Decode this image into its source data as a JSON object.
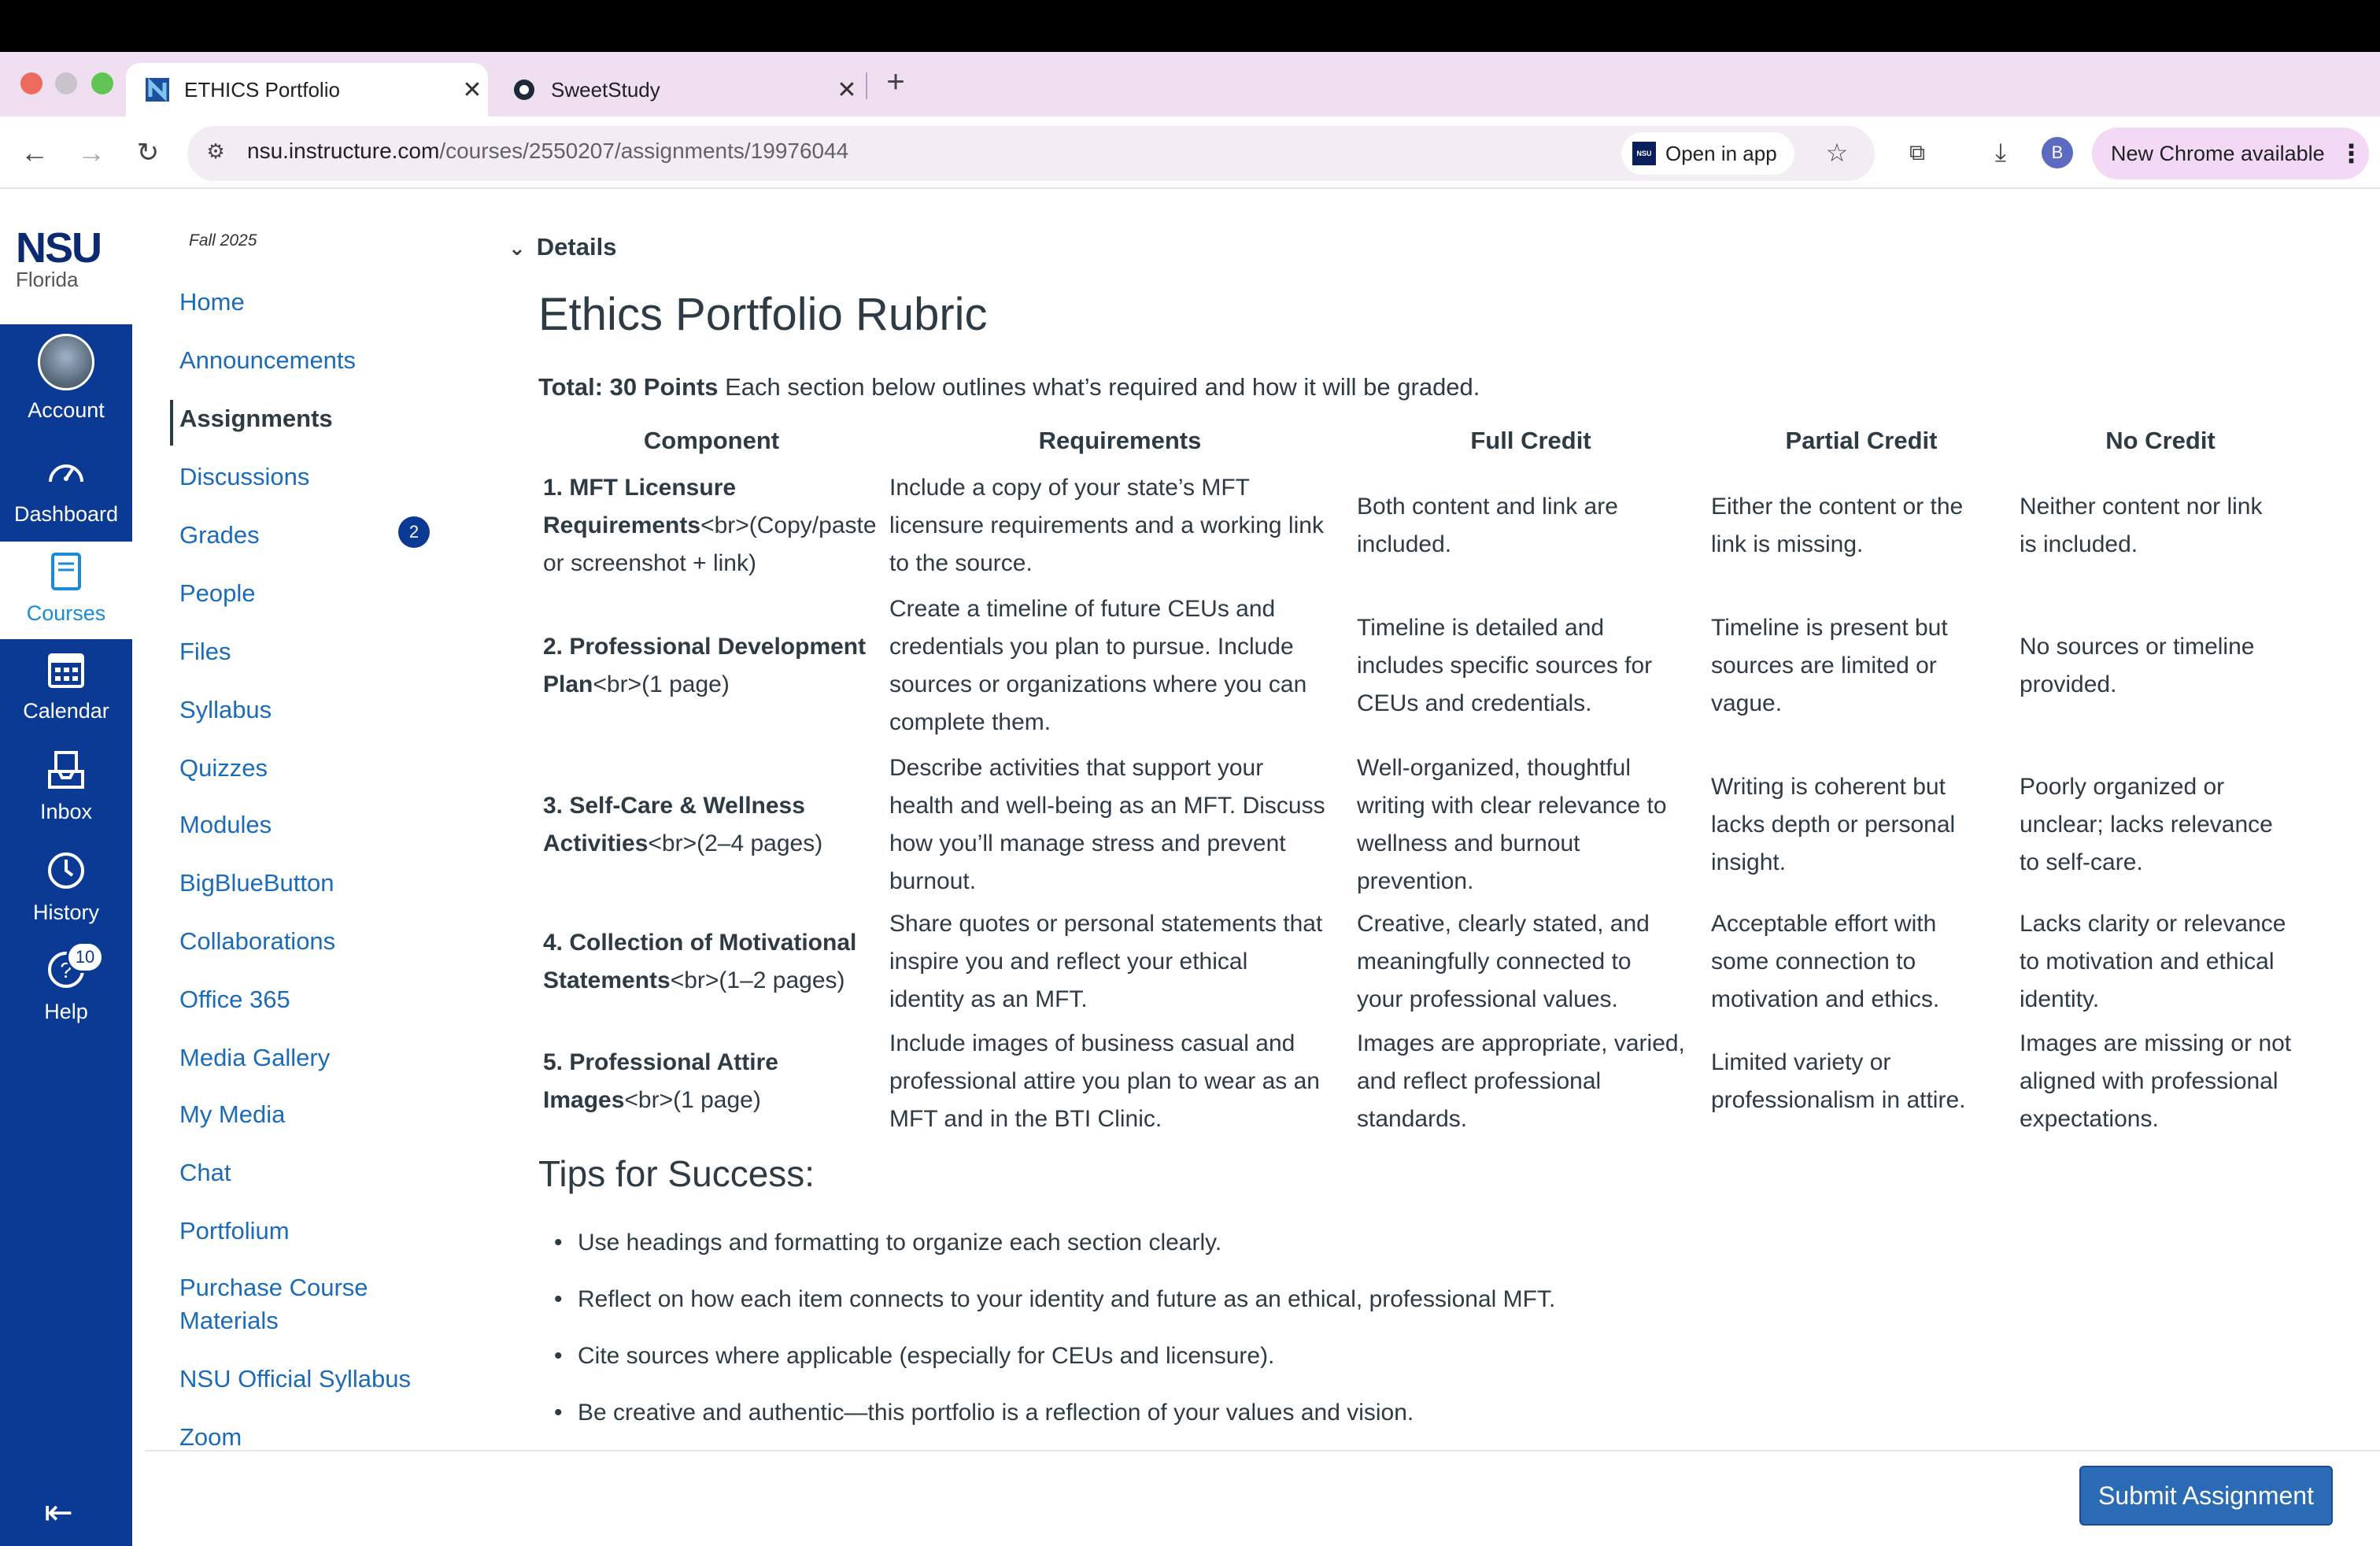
{
  "browser": {
    "tabs": [
      {
        "label": "ETHICS Portfolio",
        "active": true
      },
      {
        "label": "SweetStudy",
        "active": false
      }
    ],
    "url_host": "nsu.instructure.com",
    "url_path": "/courses/2550207/assignments/19976044",
    "open_in_app": "Open in app",
    "open_in_app_icon_text": "NSU",
    "profile_initial": "B",
    "new_chrome": "New Chrome available"
  },
  "global_nav": {
    "logo_main": "NSU",
    "logo_sub": "Florida",
    "items": [
      {
        "label": "Account",
        "icon": "account-avatar"
      },
      {
        "label": "Dashboard",
        "icon": "dashboard-icon"
      },
      {
        "label": "Courses",
        "icon": "courses-icon"
      },
      {
        "label": "Calendar",
        "icon": "calendar-icon"
      },
      {
        "label": "Inbox",
        "icon": "inbox-icon"
      },
      {
        "label": "History",
        "icon": "history-icon"
      },
      {
        "label": "Help",
        "icon": "help-icon"
      }
    ],
    "help_badge": "10"
  },
  "course_nav": {
    "term": "Fall 2025",
    "items": [
      "Home",
      "Announcements",
      "Assignments",
      "Discussions",
      "Grades",
      "People",
      "Files",
      "Syllabus",
      "Quizzes",
      "Modules",
      "BigBlueButton",
      "Collaborations",
      "Office 365",
      "Media Gallery",
      "My Media",
      "Chat",
      "Portfolium",
      "Purchase Course",
      "Materials",
      "NSU Official Syllabus",
      "Zoom"
    ],
    "grades_badge": "2"
  },
  "main": {
    "details_label": "Details",
    "title": "Ethics Portfolio Rubric",
    "total_bold": "Total: 30 Points",
    "total_rest": " Each section below outlines what’s required and how it will be graded.",
    "table": {
      "headers": [
        "Component",
        "Requirements",
        "Full Credit",
        "Partial Credit",
        "No Credit"
      ],
      "rows": [
        {
          "component": [
            "1. MFT Licensure",
            "Requirements",
            "<br>(Copy/paste",
            "or screenshot + link)"
          ],
          "requirements": [
            "Include a copy of your state’s MFT",
            "licensure requirements and a working link",
            "to the source."
          ],
          "full": [
            "Both content and link are",
            "included."
          ],
          "partial": [
            "Either the content or the",
            "link is missing."
          ],
          "none": [
            "Neither content nor link",
            "is included."
          ]
        },
        {
          "component": [
            "2. Professional Development",
            "Plan",
            "<br>(1 page)"
          ],
          "requirements": [
            "Create a timeline of future CEUs and",
            "credentials you plan to pursue. Include",
            "sources or organizations where you can",
            "complete them."
          ],
          "full": [
            "Timeline is detailed and",
            "includes specific sources for",
            "CEUs and credentials."
          ],
          "partial": [
            "Timeline is present but",
            "sources are limited or",
            "vague."
          ],
          "none": [
            "No sources or timeline",
            "provided."
          ]
        },
        {
          "component": [
            "3. Self-Care & Wellness",
            "Activities",
            "<br>(2–4 pages)"
          ],
          "requirements": [
            "Describe activities that support your",
            "health and well-being as an MFT. Discuss",
            "how you’ll manage stress and prevent",
            "burnout."
          ],
          "full": [
            "Well-organized, thoughtful",
            "writing with clear relevance to",
            "wellness and burnout",
            "prevention."
          ],
          "partial": [
            "Writing is coherent but",
            "lacks depth or personal",
            "insight."
          ],
          "none": [
            "Poorly organized or",
            "unclear; lacks relevance",
            "to self-care."
          ]
        },
        {
          "component": [
            "4. Collection of Motivational",
            "Statements",
            "<br>(1–2 pages)"
          ],
          "requirements": [
            "Share quotes or personal statements that",
            "inspire you and reflect your ethical",
            "identity as an MFT."
          ],
          "full": [
            "Creative, clearly stated, and",
            "meaningfully connected to",
            "your professional values."
          ],
          "partial": [
            "Acceptable effort with",
            "some connection to",
            "motivation and ethics."
          ],
          "none": [
            "Lacks clarity or relevance",
            "to motivation and ethical",
            "identity."
          ]
        },
        {
          "component": [
            "5. Professional Attire",
            "Images",
            "<br>(1 page)"
          ],
          "requirements": [
            "Include images of business casual and",
            "professional attire you plan to wear as an",
            "MFT and in the BTI Clinic."
          ],
          "full": [
            "Images are appropriate, varied,",
            "and reflect professional",
            "standards."
          ],
          "partial": [
            "Limited variety or",
            "professionalism in attire."
          ],
          "none": [
            "Images are missing or not",
            "aligned with professional",
            "expectations."
          ]
        }
      ]
    },
    "tips_title": "Tips for Success:",
    "tips": [
      "Use headings and formatting to organize each section clearly.",
      "Reflect on how each item connects to your identity and future as an ethical, professional MFT.",
      "Cite sources where applicable (especially for CEUs and licensure).",
      "Be creative and authentic—this portfolio is a reflection of your values and vision."
    ],
    "submit_label": "Submit Assignment"
  },
  "colors": {
    "global_nav_bg": "#0b3a94",
    "link": "#1c6bb8",
    "submit_bg": "#2b6ab5",
    "tabstrip_bg": "#efdff1"
  }
}
